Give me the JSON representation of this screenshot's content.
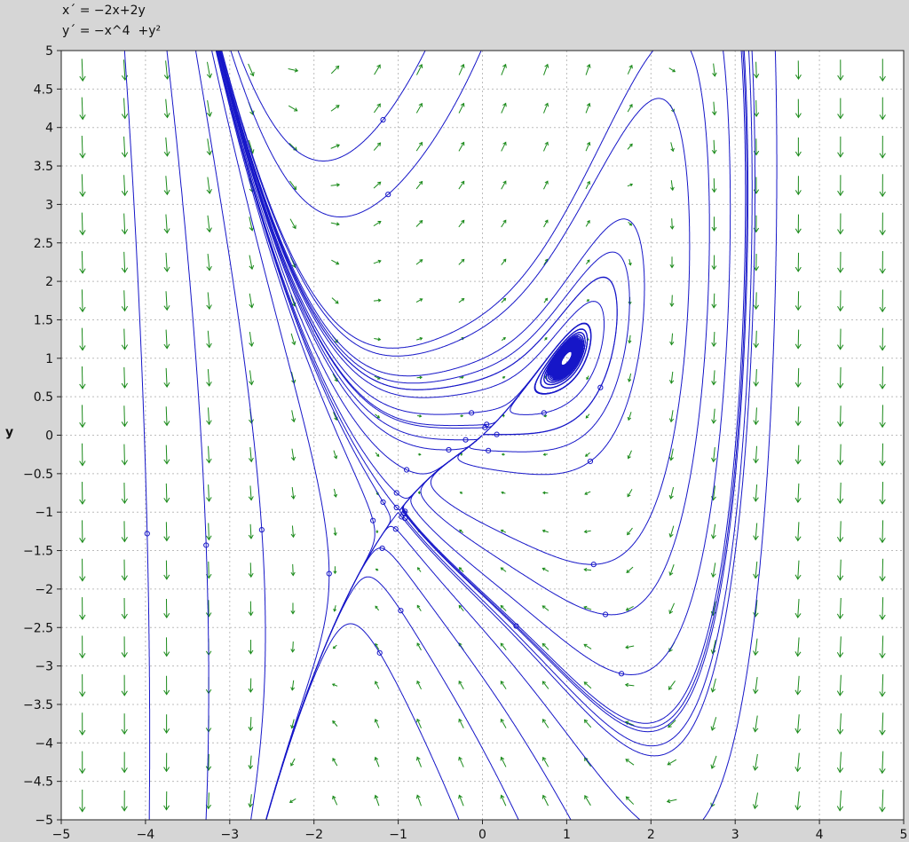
{
  "equations": {
    "x_prime": "x´ = −2x+2y",
    "y_prime": "y´ = −x^4  +y²"
  },
  "chart_data": {
    "type": "phase-portrait",
    "title": "",
    "system": {
      "dx": "-2x+2y",
      "dy": "-x^4+y^2"
    },
    "xlabel": "",
    "ylabel": "y",
    "xlim": [
      -5,
      5
    ],
    "ylim": [
      -5,
      5
    ],
    "grid": true,
    "x_ticks": [
      "−5",
      "−4",
      "−3",
      "−2",
      "−1",
      "0",
      "1",
      "2",
      "3",
      "4",
      "5"
    ],
    "y_ticks": [
      "5",
      "4.5",
      "4",
      "3.5",
      "3",
      "2.5",
      "2",
      "1.5",
      "1",
      "0.5",
      "0",
      "−0.5",
      "−1",
      "−1.5",
      "−2",
      "−2.5",
      "−3",
      "−3.5",
      "−4",
      "−4.5",
      "−5"
    ],
    "equilibria": [
      [
        -1,
        -1
      ],
      [
        0,
        0
      ],
      [
        1,
        1
      ]
    ],
    "initial_points": [
      [
        -3.98,
        -1.28
      ],
      [
        -3.28,
        -1.43
      ],
      [
        -2.62,
        -1.23
      ],
      [
        -1.82,
        -1.8
      ],
      [
        -1.22,
        -2.83
      ],
      [
        -0.97,
        -2.28
      ],
      [
        -1.19,
        -1.47
      ],
      [
        -1.03,
        -1.22
      ],
      [
        -1.3,
        -1.11
      ],
      [
        -1.18,
        -0.87
      ],
      [
        -1.02,
        -0.75
      ],
      [
        -1.02,
        -0.94
      ],
      [
        -0.93,
        -1.01
      ],
      [
        -0.96,
        -1.06
      ],
      [
        -0.92,
        -1.08
      ],
      [
        -0.92,
        -0.99
      ],
      [
        -0.9,
        -0.45
      ],
      [
        -0.4,
        -0.19
      ],
      [
        -0.2,
        -0.06
      ],
      [
        -0.13,
        0.29
      ],
      [
        0.03,
        0.1
      ],
      [
        0.05,
        0.14
      ],
      [
        0.17,
        0.01
      ],
      [
        0.07,
        -0.2
      ],
      [
        0.73,
        0.29
      ],
      [
        1.4,
        0.62
      ],
      [
        1.28,
        -0.34
      ],
      [
        1.32,
        -1.68
      ],
      [
        1.46,
        -2.33
      ],
      [
        1.65,
        -3.1
      ],
      [
        0.4,
        -2.48
      ],
      [
        -1.18,
        4.1
      ],
      [
        -1.12,
        3.13
      ]
    ],
    "colors": {
      "background": "#d6d6d6",
      "plot": "#ffffff",
      "trajectory": "#1616c8",
      "arrows": "#1a8a1a",
      "grid": "#bcbcbc"
    }
  }
}
